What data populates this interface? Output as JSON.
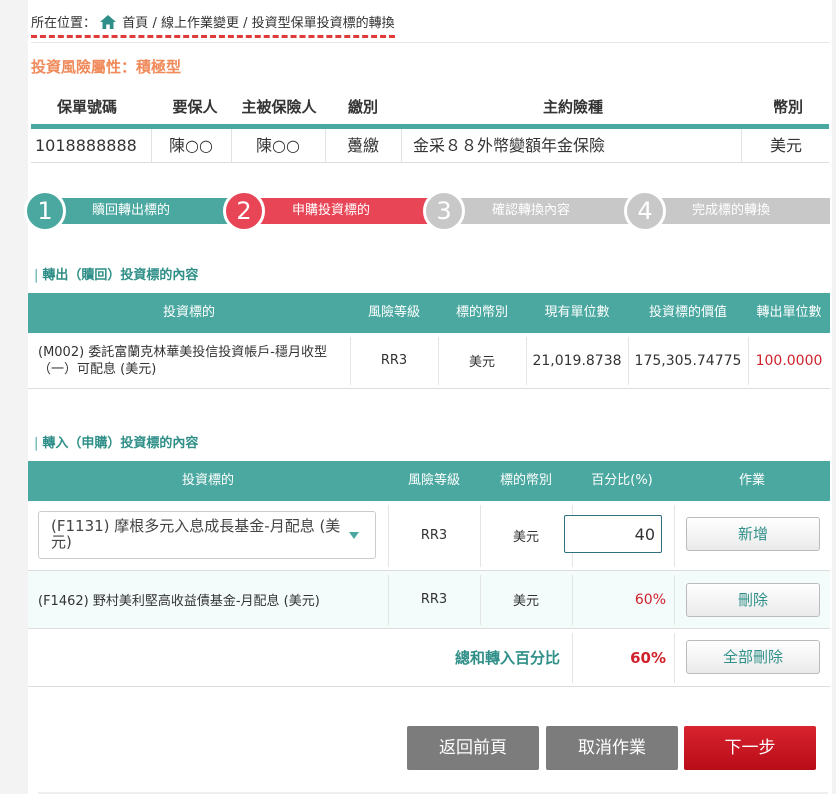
{
  "breadcrumb": {
    "prefix": "所在位置：",
    "home": "首頁",
    "sep1": " / ",
    "level2": "線上作業變更",
    "sep2": " / ",
    "level3": "投資型保單投資標的轉換"
  },
  "risk_title": "投資風險屬性：積極型",
  "policy": {
    "headers": [
      "保單號碼",
      "要保人",
      "主被保險人",
      "繳別",
      "主約險種",
      "幣別"
    ],
    "row": [
      "1018888888",
      "陳○○",
      "陳○○",
      "躉繳",
      "金采８８外幣變額年金保險",
      "美元"
    ]
  },
  "steps": [
    {
      "num": "1",
      "label": "贖回轉出標的",
      "color": "#4aa8a0"
    },
    {
      "num": "2",
      "label": "申購投資標的",
      "color": "#e84556"
    },
    {
      "num": "3",
      "label": "確認轉換內容",
      "color": "#c8c8c8"
    },
    {
      "num": "4",
      "label": "完成標的轉換",
      "color": "#c8c8c8"
    }
  ],
  "out_section": {
    "title": "轉出（贖回）投資標的內容",
    "headers": [
      "投資標的",
      "風險等級",
      "標的幣別",
      "現有單位數",
      "投資標的價值",
      "轉出單位數"
    ],
    "rows": [
      {
        "name": "(M002) 委託富蘭克林華美投信投資帳戶-穩月收型（一）可配息 (美元)",
        "risk": "RR3",
        "currency": "美元",
        "units": "21,019.8738",
        "value": "175,305.74775",
        "out_units": "100.0000"
      }
    ]
  },
  "in_section": {
    "title": "轉入（申購）投資標的內容",
    "headers": [
      "投資標的",
      "風險等級",
      "標的幣別",
      "百分比(%)",
      "作業"
    ],
    "edit_row": {
      "selected": "(F1131) 摩根多元入息成長基金-月配息 (美元)",
      "risk": "RR3",
      "currency": "美元",
      "percent": "40",
      "action": "新增"
    },
    "rows": [
      {
        "name": "(F1462) 野村美利堅高收益債基金-月配息 (美元)",
        "risk": "RR3",
        "currency": "美元",
        "percent": "60%",
        "action": "刪除"
      }
    ],
    "total_label": "總和轉入百分比",
    "total_value": "60%",
    "delete_all": "全部刪除"
  },
  "buttons": {
    "back": "返回前頁",
    "cancel": "取消作業",
    "next": "下一步"
  },
  "colors": {
    "teal": "#4aa8a0",
    "red": "#e84556",
    "gray": "#c8c8c8",
    "orange": "#f08a5a",
    "next_button": "#c8101e",
    "dark_button": "#7c7c7c"
  }
}
